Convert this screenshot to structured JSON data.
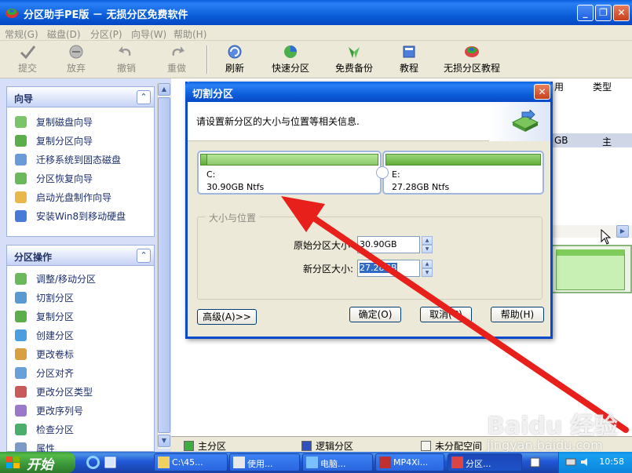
{
  "window": {
    "title": "分区助手PE版 － 无损分区免费软件",
    "controls": [
      "minimize",
      "maximize",
      "close"
    ]
  },
  "menu": [
    "常规(G)",
    "磁盘(D)",
    "分区(P)",
    "向导(W)",
    "帮助(H)"
  ],
  "toolbar": {
    "commit": "提交",
    "discard": "放弃",
    "undo": "撤销",
    "redo": "重做",
    "refresh": "刷新",
    "quick_partition": "快速分区",
    "free_backup": "免费备份",
    "tutorial": "教程",
    "lossless_tutorial": "无损分区教程"
  },
  "wizard_panel": {
    "title": "向导",
    "items": [
      "复制磁盘向导",
      "复制分区向导",
      "迁移系统到固态磁盘",
      "分区恢复向导",
      "启动光盘制作向导",
      "安装Win8到移动硬盘"
    ]
  },
  "partition_panel": {
    "title": "分区操作",
    "items": [
      "调整/移动分区",
      "切割分区",
      "复制分区",
      "创建分区",
      "更改卷标",
      "分区对齐",
      "更改分区类型",
      "更改序列号",
      "检查分区",
      "属性"
    ]
  },
  "main_grid": {
    "col_used": "用",
    "col_type": "类型",
    "row_size_tail": "GB",
    "row_type": "主"
  },
  "legend": {
    "primary": "主分区",
    "logical": "逻辑分区",
    "unallocated": "未分配空间",
    "colors": {
      "primary": "#3fae3f",
      "logical": "#3050c0",
      "unallocated": "#f4f4ec"
    }
  },
  "dialog": {
    "title": "切割分区",
    "instruction": "请设置新分区的大小与位置等相关信息.",
    "left_partition": {
      "drive": "C:",
      "info": "30.90GB Ntfs",
      "used_fraction": 0.04
    },
    "right_partition": {
      "drive": "E:",
      "info": "27.28GB Ntfs",
      "used_fraction": 1.0
    },
    "group_title": "大小与位置",
    "original_size_label": "原始分区大小",
    "original_size_value": "30.90GB",
    "new_size_label": "新分区大小:",
    "new_size_value": "27.28GB",
    "advanced_button": "高级(A)>>",
    "ok_button": "确定(O)",
    "cancel_button": "取消(C)",
    "help_button": "帮助(H)"
  },
  "watermark": {
    "main": "Baidu 经验",
    "sub": "jingyan.baidu.com"
  },
  "taskbar": {
    "start": "开始",
    "tasks": [
      "C:\\45...",
      "使用...",
      "电脑...",
      "MP4Xi...",
      "分区..."
    ],
    "clock": "10:58"
  }
}
